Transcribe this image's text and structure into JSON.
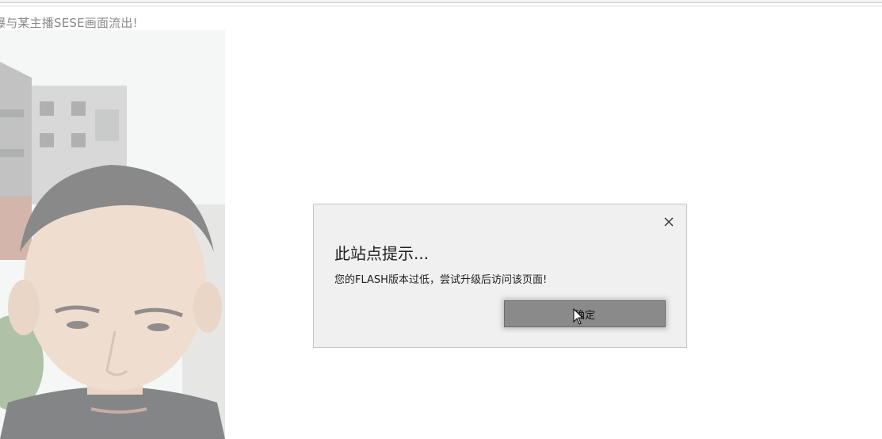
{
  "page": {
    "headline": "曝与某主播SESE画面流出!"
  },
  "dialog": {
    "title": "此站点提示...",
    "message": "您的FLASH版本过低，尝试升级后访问该页面!",
    "ok_label": "确定",
    "close_icon": "close-icon"
  },
  "colors": {
    "dialog_bg": "#f0f0f0",
    "button_bg": "#8a8a8a",
    "headline_text": "#8a8a8a"
  }
}
